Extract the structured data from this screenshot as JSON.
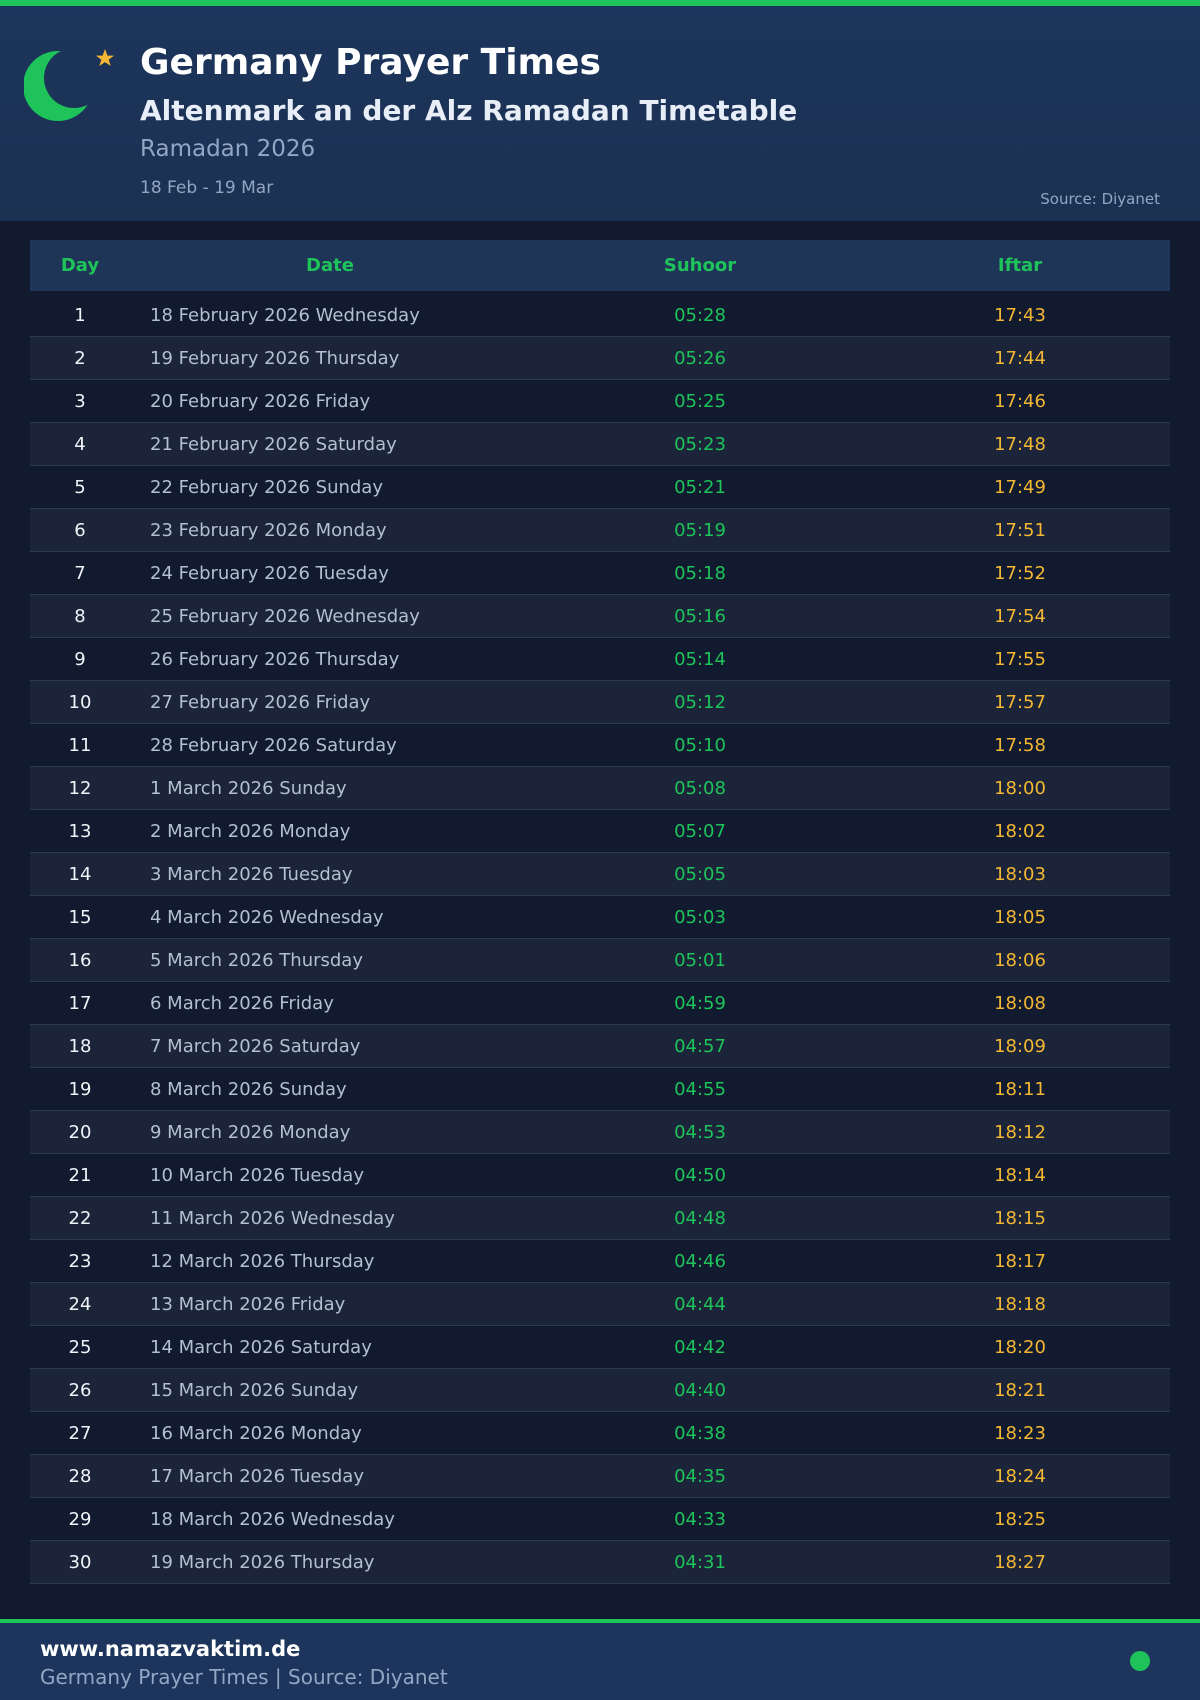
{
  "header": {
    "title": "Germany Prayer Times",
    "subtitle": "Altenmark an der Alz Ramadan Timetable",
    "season": "Ramadan 2026",
    "range": "18 Feb - 19 Mar",
    "source": "Source: Diyanet"
  },
  "colors": {
    "accent": "#1ec35a",
    "iftar": "#f4b733",
    "header_bg": "#1d355c",
    "page_bg": "#111a2e"
  },
  "icons": {
    "logo": "crescent-star-icon",
    "status": "status-dot-icon"
  },
  "table": {
    "headers": {
      "day": "Day",
      "date": "Date",
      "suhoor": "Suhoor",
      "iftar": "Iftar"
    },
    "rows": [
      {
        "day": "1",
        "date": "18 February 2026 Wednesday",
        "suhoor": "05:28",
        "iftar": "17:43"
      },
      {
        "day": "2",
        "date": "19 February 2026 Thursday",
        "suhoor": "05:26",
        "iftar": "17:44"
      },
      {
        "day": "3",
        "date": "20 February 2026 Friday",
        "suhoor": "05:25",
        "iftar": "17:46"
      },
      {
        "day": "4",
        "date": "21 February 2026 Saturday",
        "suhoor": "05:23",
        "iftar": "17:48"
      },
      {
        "day": "5",
        "date": "22 February 2026 Sunday",
        "suhoor": "05:21",
        "iftar": "17:49"
      },
      {
        "day": "6",
        "date": "23 February 2026 Monday",
        "suhoor": "05:19",
        "iftar": "17:51"
      },
      {
        "day": "7",
        "date": "24 February 2026 Tuesday",
        "suhoor": "05:18",
        "iftar": "17:52"
      },
      {
        "day": "8",
        "date": "25 February 2026 Wednesday",
        "suhoor": "05:16",
        "iftar": "17:54"
      },
      {
        "day": "9",
        "date": "26 February 2026 Thursday",
        "suhoor": "05:14",
        "iftar": "17:55"
      },
      {
        "day": "10",
        "date": "27 February 2026 Friday",
        "suhoor": "05:12",
        "iftar": "17:57"
      },
      {
        "day": "11",
        "date": "28 February 2026 Saturday",
        "suhoor": "05:10",
        "iftar": "17:58"
      },
      {
        "day": "12",
        "date": "1 March 2026 Sunday",
        "suhoor": "05:08",
        "iftar": "18:00"
      },
      {
        "day": "13",
        "date": "2 March 2026 Monday",
        "suhoor": "05:07",
        "iftar": "18:02"
      },
      {
        "day": "14",
        "date": "3 March 2026 Tuesday",
        "suhoor": "05:05",
        "iftar": "18:03"
      },
      {
        "day": "15",
        "date": "4 March 2026 Wednesday",
        "suhoor": "05:03",
        "iftar": "18:05"
      },
      {
        "day": "16",
        "date": "5 March 2026 Thursday",
        "suhoor": "05:01",
        "iftar": "18:06"
      },
      {
        "day": "17",
        "date": "6 March 2026 Friday",
        "suhoor": "04:59",
        "iftar": "18:08"
      },
      {
        "day": "18",
        "date": "7 March 2026 Saturday",
        "suhoor": "04:57",
        "iftar": "18:09"
      },
      {
        "day": "19",
        "date": "8 March 2026 Sunday",
        "suhoor": "04:55",
        "iftar": "18:11"
      },
      {
        "day": "20",
        "date": "9 March 2026 Monday",
        "suhoor": "04:53",
        "iftar": "18:12"
      },
      {
        "day": "21",
        "date": "10 March 2026 Tuesday",
        "suhoor": "04:50",
        "iftar": "18:14"
      },
      {
        "day": "22",
        "date": "11 March 2026 Wednesday",
        "suhoor": "04:48",
        "iftar": "18:15"
      },
      {
        "day": "23",
        "date": "12 March 2026 Thursday",
        "suhoor": "04:46",
        "iftar": "18:17"
      },
      {
        "day": "24",
        "date": "13 March 2026 Friday",
        "suhoor": "04:44",
        "iftar": "18:18"
      },
      {
        "day": "25",
        "date": "14 March 2026 Saturday",
        "suhoor": "04:42",
        "iftar": "18:20"
      },
      {
        "day": "26",
        "date": "15 March 2026 Sunday",
        "suhoor": "04:40",
        "iftar": "18:21"
      },
      {
        "day": "27",
        "date": "16 March 2026 Monday",
        "suhoor": "04:38",
        "iftar": "18:23"
      },
      {
        "day": "28",
        "date": "17 March 2026 Tuesday",
        "suhoor": "04:35",
        "iftar": "18:24"
      },
      {
        "day": "29",
        "date": "18 March 2026 Wednesday",
        "suhoor": "04:33",
        "iftar": "18:25"
      },
      {
        "day": "30",
        "date": "19 March 2026 Thursday",
        "suhoor": "04:31",
        "iftar": "18:27"
      }
    ]
  },
  "footer": {
    "site": "www.namazvaktim.de",
    "text": "Germany Prayer Times | Source: Diyanet"
  }
}
